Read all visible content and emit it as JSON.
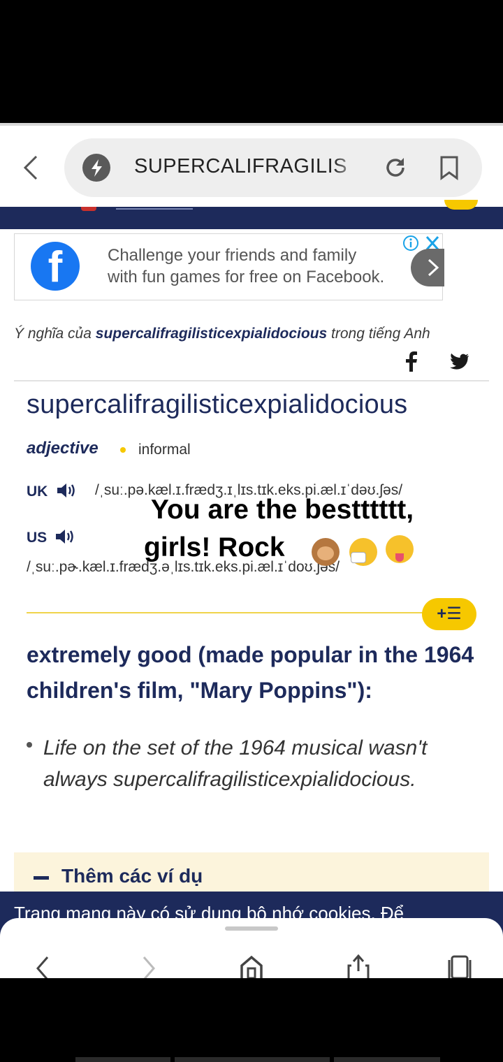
{
  "browser": {
    "url": "SUPERCALIFRAGILIS",
    "icons": {
      "back": "chevron-left-icon",
      "site": "bolt-icon",
      "reload": "reload-icon",
      "bookmark": "bookmark-icon"
    }
  },
  "ad": {
    "line1": "Challenge your friends and family",
    "line2": "with fun games for free on Facebook.",
    "logo_letter": "f",
    "icons": {
      "info": "ad-info-icon",
      "close": "ad-close-icon",
      "next": "chevron-right-icon"
    }
  },
  "meaning": {
    "prefix": "Ý nghĩa của ",
    "word": "supercalifragilisticexpialidocious",
    "suffix": " trong tiếng Anh"
  },
  "entry": {
    "headword": "supercalifragilisticexpialidocious",
    "pos": "adjective",
    "register": "informal",
    "uk_label": "UK",
    "uk_ipa": "/ˌsuː.pə.kæl.ɪ.frædʒ.ɪˌlɪs.tɪk.eks.pi.æl.ɪˈdəʊ.ʃəs/",
    "us_label": "US",
    "us_ipa": "/ˌsuː.pɚ.kæl.ɪ.frædʒ.əˌlɪs.tɪk.eks.pi.æl.ɪˈdoʊ.ʃəs/",
    "definition": "extremely good (made popular in the 1964 children's film, \"Mary Poppins\"):",
    "example": "Life on the set of the 1964 musical wasn't always supercalifragilisticexpialidocious.",
    "add_list": "+☰",
    "more_examples": "Thêm các ví dụ"
  },
  "overlay": {
    "line1": "You are the bestttttt,",
    "line2": "girls! Rock",
    "emojis": [
      "see-no-evil-monkey-icon",
      "sneezing-face-icon",
      "zany-face-icon"
    ]
  },
  "cookie": {
    "text": "Trang mạng này có sử dụng bộ nhớ cookies. Để"
  },
  "colors": {
    "navy": "#1d2a5b",
    "yellow": "#f6c800",
    "facebook": "#1877f2"
  }
}
